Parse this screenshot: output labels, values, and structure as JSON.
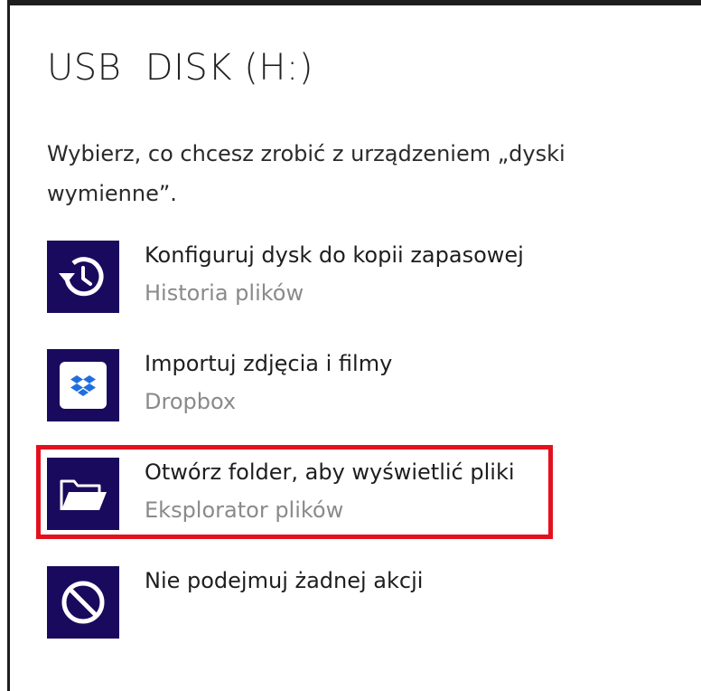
{
  "dialog": {
    "title": "USB  DISK (H:)",
    "description": "Wybierz, co chcesz zrobić z urządzeniem „dyski wymienne”."
  },
  "options": [
    {
      "label": "Konfiguruj dysk do kopii zapasowej",
      "sublabel": "Historia plików",
      "icon": "history-clock-icon"
    },
    {
      "label": "Importuj zdjęcia i filmy",
      "sublabel": "Dropbox",
      "icon": "dropbox-icon"
    },
    {
      "label": "Otwórz folder, aby wyświetlić pliki",
      "sublabel": "Eksplorator plików",
      "icon": "folder-open-icon",
      "highlighted": true
    },
    {
      "label": "Nie podejmuj żadnej akcji",
      "sublabel": "",
      "icon": "no-action-icon"
    }
  ],
  "colors": {
    "tile_background": "#1a0a5e",
    "highlight_border": "#e4101e",
    "dropbox_blue": "#1f6fe0",
    "sublabel_gray": "#8a8a8a"
  }
}
